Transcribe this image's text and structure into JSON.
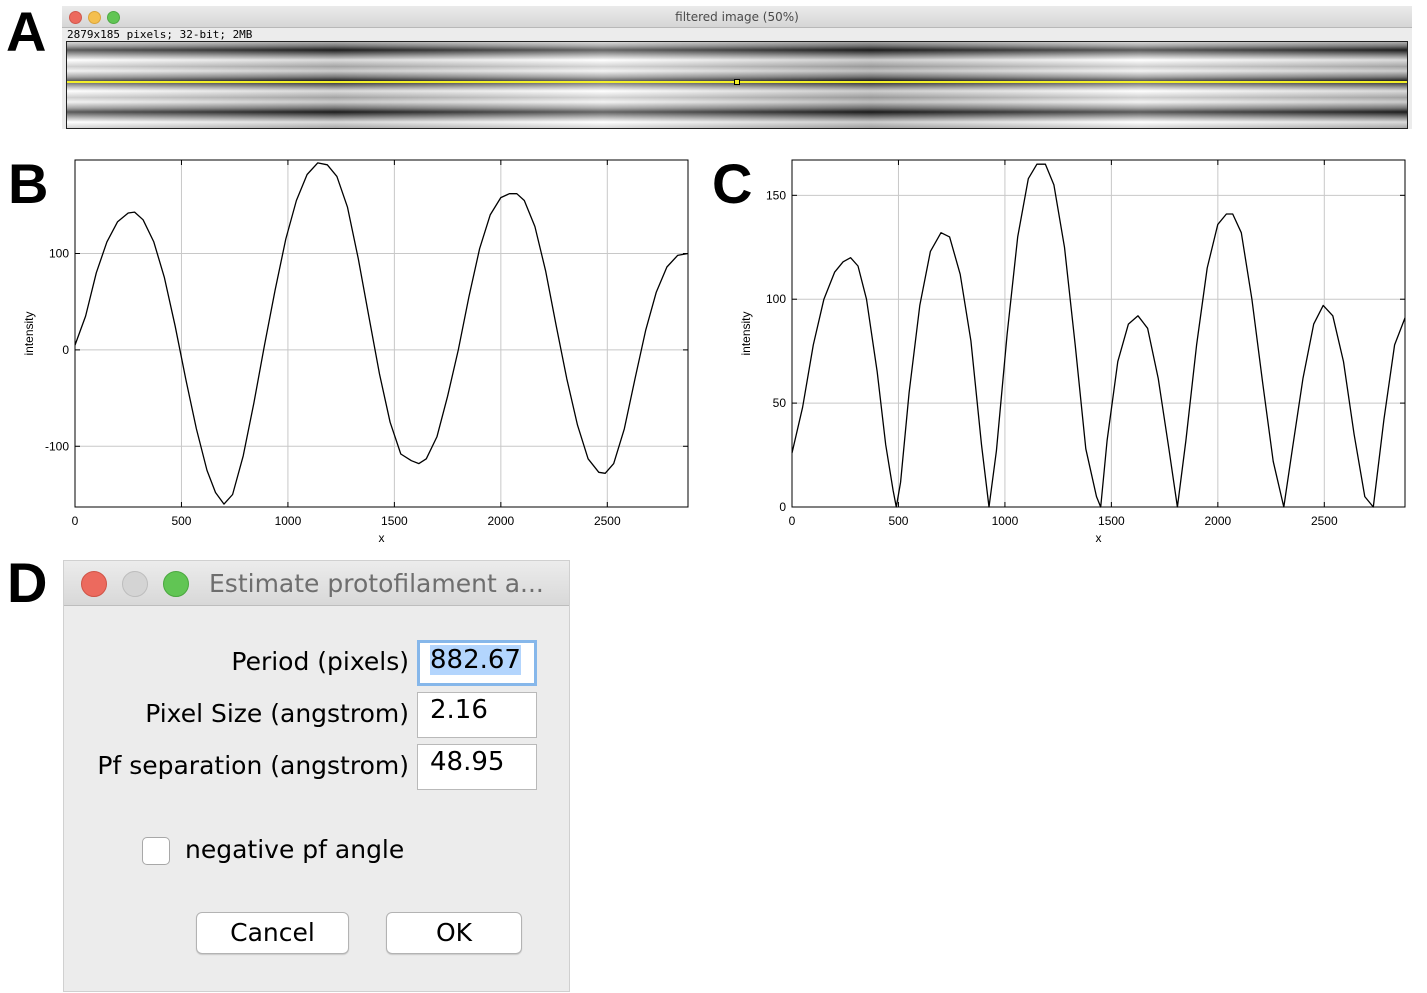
{
  "panel_labels": {
    "a": "A",
    "b": "B",
    "c": "C",
    "d": "D"
  },
  "image_window": {
    "title": "filtered image (50%)",
    "info": "2879x185 pixels; 32-bit; 2MB",
    "selection_color": "#f3ef2a"
  },
  "chart_data": [
    {
      "type": "line",
      "xlabel": "x",
      "ylabel": "intensity",
      "xlim": [
        0,
        2879
      ],
      "ylim": [
        -163,
        197
      ],
      "x_ticks": [
        0,
        500,
        1000,
        1500,
        2000,
        2500
      ],
      "y_ticks": [
        -100,
        0,
        100
      ],
      "grid": true,
      "series": [
        {
          "x": [
            0,
            50,
            100,
            150,
            200,
            250,
            280,
            320,
            370,
            420,
            470,
            520,
            570,
            620,
            660,
            700,
            740,
            790,
            840,
            890,
            940,
            990,
            1040,
            1090,
            1140,
            1185,
            1230,
            1280,
            1330,
            1380,
            1430,
            1480,
            1530,
            1580,
            1615,
            1650,
            1700,
            1750,
            1800,
            1850,
            1900,
            1950,
            2000,
            2040,
            2075,
            2110,
            2160,
            2210,
            2260,
            2310,
            2360,
            2410,
            2460,
            2490,
            2530,
            2580,
            2630,
            2680,
            2730,
            2780,
            2830,
            2879
          ],
          "y": [
            5,
            35,
            80,
            112,
            133,
            142,
            143,
            135,
            112,
            75,
            25,
            -30,
            -82,
            -125,
            -148,
            -160,
            -150,
            -110,
            -55,
            5,
            62,
            115,
            155,
            182,
            194,
            192,
            180,
            148,
            95,
            35,
            -25,
            -75,
            -108,
            -115,
            -118,
            -113,
            -90,
            -48,
            0,
            55,
            105,
            140,
            158,
            162,
            162,
            155,
            128,
            82,
            25,
            -30,
            -78,
            -113,
            -127,
            -128,
            -118,
            -82,
            -30,
            20,
            60,
            86,
            98,
            100
          ]
        }
      ]
    },
    {
      "type": "line",
      "xlabel": "x",
      "ylabel": "intensity",
      "xlim": [
        0,
        2879
      ],
      "ylim": [
        0,
        167
      ],
      "x_ticks": [
        0,
        500,
        1000,
        1500,
        2000,
        2500
      ],
      "y_ticks": [
        0,
        50,
        100,
        150
      ],
      "grid": true,
      "series": [
        {
          "x": [
            0,
            50,
            100,
            150,
            200,
            240,
            275,
            310,
            350,
            400,
            440,
            475,
            490,
            510,
            550,
            600,
            650,
            700,
            740,
            790,
            840,
            890,
            925,
            960,
            1010,
            1060,
            1110,
            1150,
            1190,
            1230,
            1280,
            1330,
            1380,
            1430,
            1450,
            1480,
            1530,
            1580,
            1625,
            1670,
            1720,
            1770,
            1810,
            1850,
            1900,
            1950,
            2000,
            2040,
            2070,
            2110,
            2160,
            2210,
            2260,
            2310,
            2350,
            2400,
            2450,
            2495,
            2540,
            2590,
            2640,
            2690,
            2730,
            2780,
            2830,
            2879
          ],
          "y": [
            26,
            48,
            78,
            100,
            113,
            118,
            120,
            116,
            100,
            65,
            30,
            8,
            0,
            12,
            55,
            97,
            123,
            132,
            130,
            112,
            80,
            30,
            0,
            27,
            83,
            130,
            158,
            165,
            165,
            155,
            125,
            78,
            28,
            5,
            0,
            32,
            70,
            88,
            92,
            86,
            62,
            28,
            0,
            32,
            78,
            115,
            136,
            141,
            141,
            132,
            100,
            60,
            22,
            0,
            28,
            62,
            88,
            97,
            92,
            70,
            35,
            5,
            0,
            42,
            78,
            91
          ]
        }
      ]
    }
  ],
  "dialog": {
    "title": "Estimate protofilament a...",
    "fields": [
      {
        "label": "Period (pixels)",
        "value": "882.67"
      },
      {
        "label": "Pixel Size (angstrom)",
        "value": "2.16"
      },
      {
        "label": "Pf separation (angstrom)",
        "value": "48.95"
      }
    ],
    "checkbox_label": "negative pf angle",
    "checkbox_checked": false,
    "cancel_label": "Cancel",
    "ok_label": "OK"
  }
}
